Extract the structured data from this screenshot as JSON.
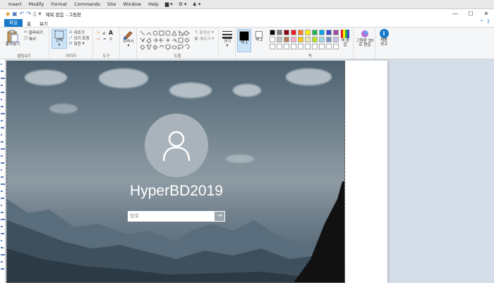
{
  "menubar": {
    "items": [
      "Insert",
      "Modify",
      "Format",
      "Commands",
      "Site",
      "Window",
      "Help"
    ]
  },
  "titlebar": {
    "title": "제목 없음 - 그림판"
  },
  "tabs": {
    "file": "파일",
    "home": "홈",
    "view": "보기"
  },
  "ribbon": {
    "clipboard": {
      "paste": "붙여넣기",
      "cut": "잘라내기",
      "copy": "복사",
      "label": "클립보드"
    },
    "image": {
      "select": "선택",
      "crop": "자르기",
      "resize": "크기 조정",
      "rotate": "회전",
      "label": "이미지"
    },
    "tools": {
      "label": "도구"
    },
    "brushes": {
      "label": "브러시"
    },
    "shapes": {
      "outline": "윤곽선",
      "fill": "채우기",
      "label": "도형"
    },
    "size": {
      "label": "크기"
    },
    "color1": {
      "label": "색 1"
    },
    "color2": {
      "label": "색 2"
    },
    "colors": {
      "edit": "색 편집",
      "label": "색"
    },
    "paint3d": {
      "label": "그림판 3D로 편집"
    },
    "product_alert": {
      "label": "제품 경고"
    }
  },
  "palette": [
    "#000000",
    "#7f7f7f",
    "#880015",
    "#ed1c24",
    "#ff7f27",
    "#fff200",
    "#22b14c",
    "#00a2e8",
    "#3f48cc",
    "#a349a4",
    "#ffffff",
    "#c3c3c3",
    "#b97a57",
    "#ffaec9",
    "#ffc90e",
    "#efe4b0",
    "#b5e61d",
    "#99d9ea",
    "#7092be",
    "#c8bfe7"
  ],
  "lockscreen": {
    "username": "HyperBD2019",
    "password_placeholder": "암호"
  }
}
